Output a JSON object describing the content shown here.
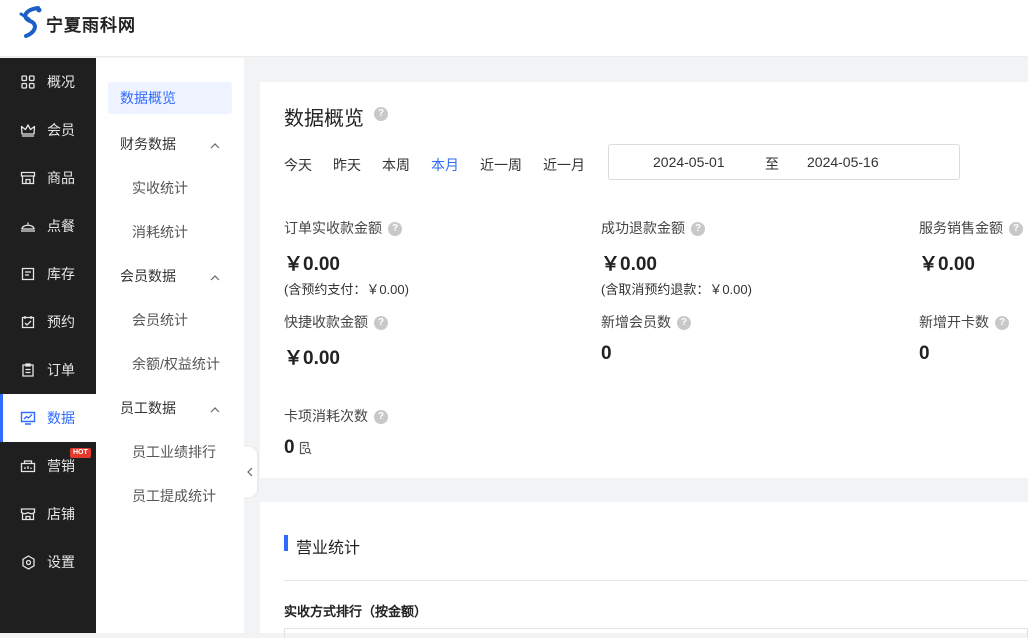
{
  "brand": {
    "name": "宁夏雨科网"
  },
  "sidebar": {
    "items": [
      {
        "label": "概况",
        "icon": "grid-icon"
      },
      {
        "label": "会员",
        "icon": "crown-icon"
      },
      {
        "label": "商品",
        "icon": "store-icon"
      },
      {
        "label": "点餐",
        "icon": "cloche-icon"
      },
      {
        "label": "库存",
        "icon": "inventory-icon"
      },
      {
        "label": "预约",
        "icon": "calendar-check-icon"
      },
      {
        "label": "订单",
        "icon": "clipboard-icon"
      },
      {
        "label": "数据",
        "icon": "chart-monitor-icon",
        "active": true
      },
      {
        "label": "营销",
        "icon": "marketing-icon",
        "badge": "HOT"
      },
      {
        "label": "店铺",
        "icon": "shop-icon"
      },
      {
        "label": "设置",
        "icon": "settings-icon"
      }
    ]
  },
  "subnav": {
    "selected": "数据概览",
    "groups": [
      {
        "label": "财务数据",
        "children": [
          "实收统计",
          "消耗统计"
        ]
      },
      {
        "label": "会员数据",
        "children": [
          "会员统计",
          "余额/权益统计"
        ]
      },
      {
        "label": "员工数据",
        "children": [
          "员工业绩排行",
          "员工提成统计"
        ]
      }
    ]
  },
  "overview": {
    "title": "数据概览",
    "help_icon": "question-icon",
    "tabs": [
      "今天",
      "昨天",
      "本周",
      "本月",
      "近一周",
      "近一月"
    ],
    "active_tab": "本月",
    "date_range": {
      "start": "2024-05-01",
      "separator": "至",
      "end": "2024-05-16"
    },
    "metrics": [
      {
        "label": "订单实收款金额",
        "value": "￥0.00",
        "note": "(含预约支付：￥0.00)"
      },
      {
        "label": "成功退款金额",
        "value": "￥0.00",
        "note": "(含取消预约退款：￥0.00)"
      },
      {
        "label": "服务销售金额",
        "value": "￥0.00"
      },
      {
        "label": "快捷收款金额",
        "value": "￥0.00"
      },
      {
        "label": "新增会员数",
        "value": "0"
      },
      {
        "label": "新增开卡数",
        "value": "0"
      },
      {
        "label": "卡项消耗次数",
        "value": "0"
      }
    ]
  },
  "business": {
    "title": "营业统计",
    "subtitle": "实收方式排行（按金额）"
  },
  "colors": {
    "accent": "#2f6bff",
    "sidebar_bg": "#1f1f1f",
    "hot": "#e23b2e"
  }
}
